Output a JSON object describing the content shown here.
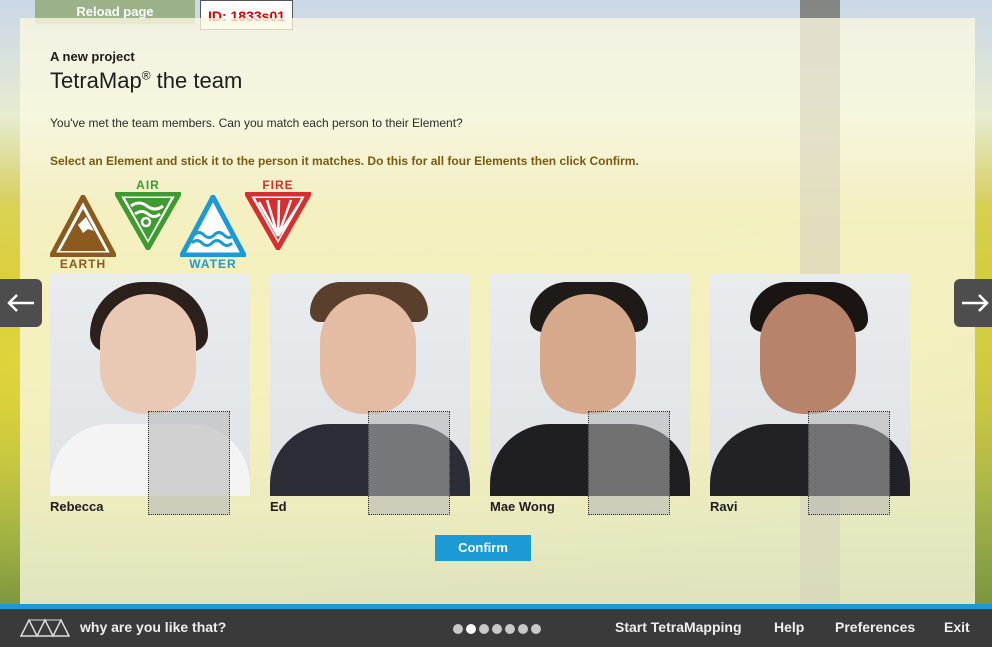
{
  "top": {
    "reload_label": "Reload page",
    "id_label": "ID: 1833s01"
  },
  "header": {
    "subtitle": "A new project",
    "title": "TetraMap",
    "title_reg": "®",
    "title_suffix": " the team"
  },
  "main": {
    "question": "You've met the team members. Can you match each person to their Element?",
    "instruction": "Select an Element and stick it to the person it matches. Do this for all four Elements then click Confirm.",
    "elements": [
      {
        "name": "EARTH",
        "color": "#8a5a1e",
        "icon": "earth-mountain-icon"
      },
      {
        "name": "AIR",
        "color": "#3f9a2f",
        "icon": "air-swirl-icon"
      },
      {
        "name": "WATER",
        "color": "#1b9ad6",
        "icon": "water-wave-icon"
      },
      {
        "name": "FIRE",
        "color": "#d72f2f",
        "icon": "fire-rays-icon"
      }
    ],
    "people": [
      {
        "name": "Rebecca"
      },
      {
        "name": "Ed"
      },
      {
        "name": "Mae Wong"
      },
      {
        "name": "Ravi"
      }
    ],
    "confirm_label": "Confirm"
  },
  "nav": {
    "prev_icon": "arrow-left-icon",
    "next_icon": "arrow-right-icon"
  },
  "footer": {
    "tagline": "why are you like that?",
    "progress_dots_total": 7,
    "progress_dots_active": 2,
    "links": [
      "Start TetraMapping",
      "Help",
      "Preferences",
      "Exit"
    ]
  }
}
